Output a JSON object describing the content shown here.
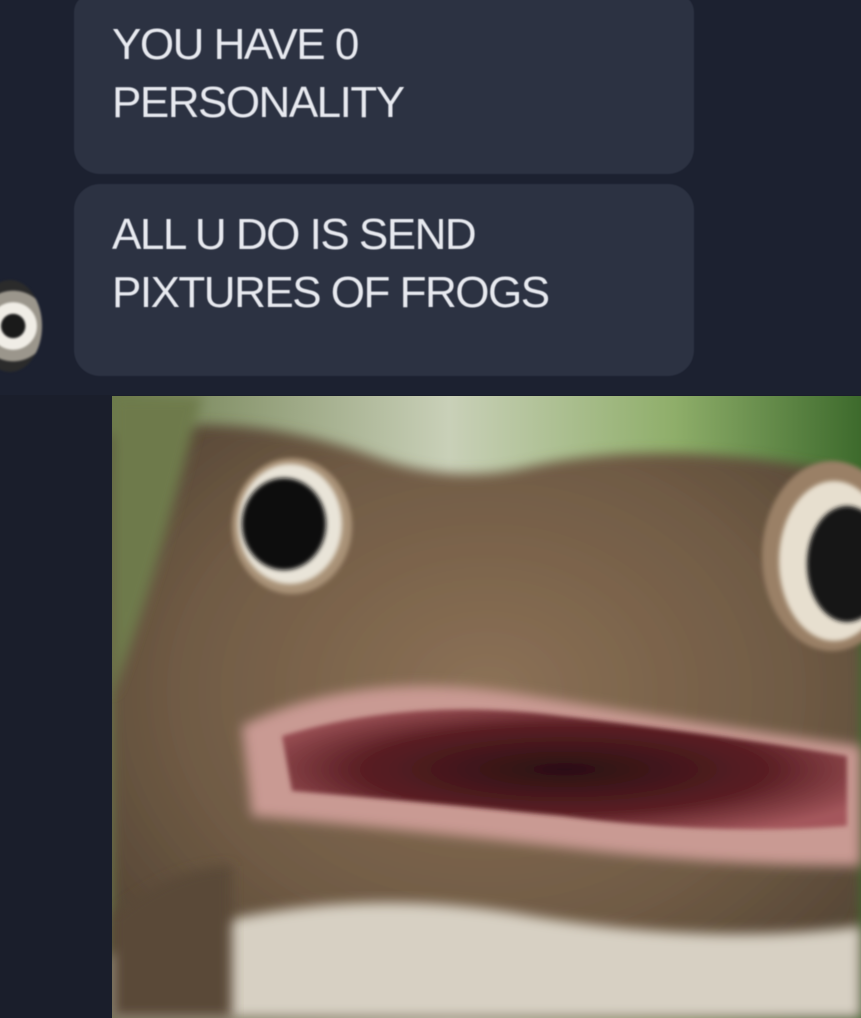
{
  "chat": {
    "messages": [
      {
        "lines": [
          "YOU HAVE 0",
          "PERSONALITY"
        ]
      },
      {
        "lines": [
          "ALL U DO IS SEND",
          "PIXTURES OF FROGS"
        ]
      }
    ],
    "attachment": {
      "subject": "frog-photo"
    }
  },
  "colors": {
    "background": "#1c2130",
    "bubble": "#2c3242",
    "bubble_text": "#e7e9ef"
  }
}
